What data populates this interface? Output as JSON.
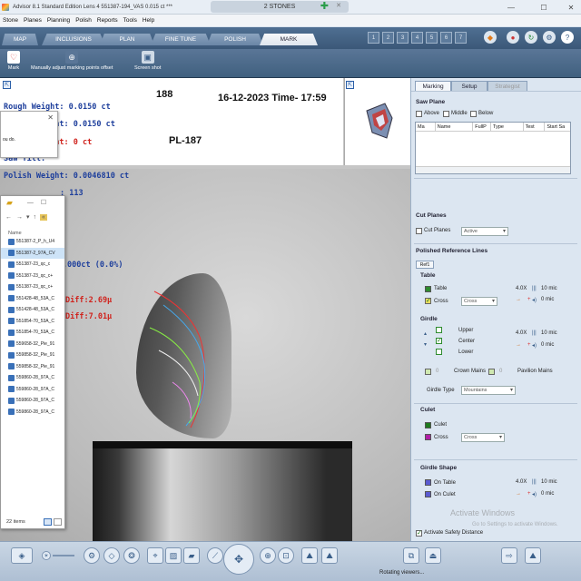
{
  "window": {
    "title": "Advisor 8.1 Standard Edition Lens 4   551387-194_VAS   0.015 ct  ***",
    "tab_label": "2 STONES"
  },
  "menu": [
    "Stone",
    "Planes",
    "Planning",
    "Polish",
    "Reports",
    "Tools",
    "Help"
  ],
  "ribbon_tabs": [
    "MAP",
    "INCLUSIONS",
    "PLAN",
    "FINE TUNE",
    "POLISH",
    "MARK"
  ],
  "active_tab": "MARK",
  "stone_slots": [
    "1",
    "2",
    "3",
    "4",
    "5",
    "6",
    "7"
  ],
  "toolbar": {
    "mark_label": "Mark",
    "manual_label": "Manually adjust marking points offset",
    "screenshot_label": "Screen shot"
  },
  "viewer": {
    "rough_weight": "Rough Weight: 0.0150 ct",
    "part_a_weight": "Part A Weight: 0.0150 ct",
    "part_b_weight": "Part B Weight: 0 ct",
    "saw_tilt": "Saw Tilt:",
    "polish_weight": "Polish Weight: 0.0046810 ct",
    "partial_113": ": 113",
    "weight_line": "eight: 0.000ct (0.0%)",
    "diff_1": "Diff:2.69µ",
    "diff_2": "Diff:7.01µ",
    "number": "188",
    "datetime": "16-12-2023 Time- 17:59",
    "pl_code": "PL-187",
    "dialog_text": "ou do."
  },
  "explorer": {
    "address": "«",
    "column_header": "Name",
    "files": [
      "551387-2_P_h_U4",
      "551387-2_97A_CV",
      "551387-23_qc_c",
      "551387-23_qc_c+",
      "551387-23_qc_c+",
      "551428-48_53A_C",
      "551428-48_53A_C",
      "551854-70_53A_C",
      "551854-70_53A_C",
      "559658-32_Pie_91",
      "559858-32_Pie_91",
      "559858-32_Pie_91",
      "559860-28_97A_C",
      "559860-28_97A_C",
      "559860-28_97A_C",
      "559860-28_97A_C"
    ],
    "item_count": "22 items"
  },
  "panel": {
    "tabs": [
      "Marking",
      "Setup",
      "Strategist"
    ],
    "saw_plane": {
      "title": "Saw Plane",
      "options": [
        "Above",
        "Middle",
        "Below"
      ],
      "columns": [
        "Ma",
        "Name",
        "FullP",
        "Type",
        "Test",
        "Start Sa"
      ]
    },
    "cut_planes": {
      "title": "Cut Planes",
      "checkbox": "Cut Planes",
      "dropdown": "Active"
    },
    "polished_reference": {
      "title": "Polished Reference Lines",
      "subtab": "Ref1",
      "table": {
        "title": "Table",
        "table_label": "Table",
        "cross_label": "Cross",
        "cross_dropdown": "Cross",
        "zoom": "4.0X",
        "mic_value": "10 mic",
        "offset": "0 mic"
      },
      "girdle": {
        "title": "Girdle",
        "upper": "Upper",
        "center": "Center",
        "lower": "Lower",
        "zoom": "4.0X",
        "mic_value": "10 mic",
        "offset": "0 mic",
        "crown_mains_val": "0",
        "crown_mains": "Crown Mains",
        "pavilion_mains_val": "0",
        "pavilion_mains": "Pavilion Mains",
        "girdle_type_label": "Girdle Type",
        "girdle_type": "Mountains"
      },
      "culet": {
        "title": "Culet",
        "culet_label": "Culet",
        "cross_label": "Cross",
        "cross_dropdown": "Cross"
      },
      "girdle_shape": {
        "title": "Girdle Shape",
        "on_table": "On Table",
        "on_culet": "On Culet",
        "zoom": "4.0X",
        "mic_value": "10 mic",
        "offset": "0 mic"
      }
    },
    "safety": "Activate Safety Distance"
  },
  "activation": {
    "line1": "Activate Windows",
    "line2": "Go to Settings to activate Windows."
  },
  "status": "Rotating viewers...",
  "colors": {
    "ribbon": "#3b5878",
    "table_swatch": "#2e8b2e",
    "cross_swatch": "#d6c21a",
    "culet_swatch": "#1e7a1e",
    "culet_cross_swatch": "#b01ea6",
    "girdle_shape_swatch": "#5a5ad0",
    "blue_text": "#1e3f9c",
    "red_text": "#d0231d"
  }
}
